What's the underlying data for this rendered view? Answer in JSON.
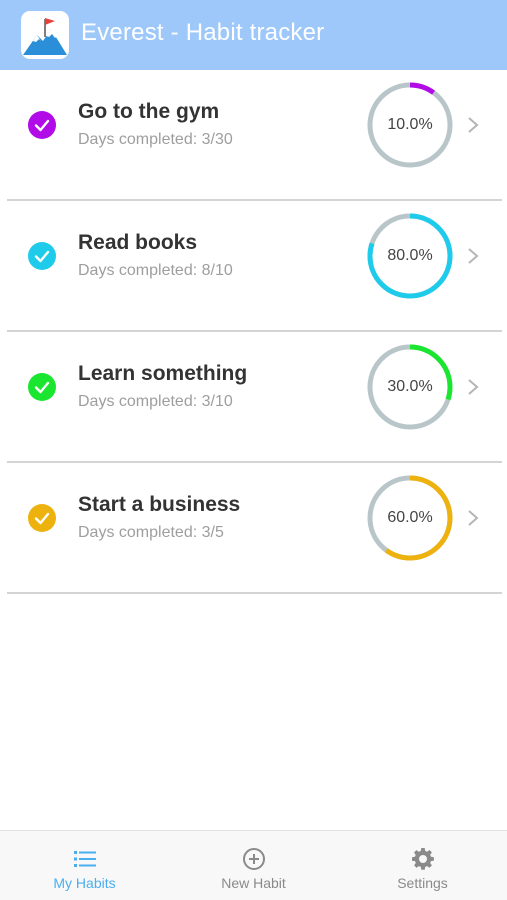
{
  "header": {
    "title": "Everest - Habit tracker",
    "icon": "mountain-flag-logo"
  },
  "habits": [
    {
      "name": "Go to the gym",
      "days": "Days completed: 3/30",
      "percent_label": "10.0%",
      "progress": 0.1,
      "color": "#b10ce8"
    },
    {
      "name": "Read books",
      "days": "Days completed: 8/10",
      "percent_label": "80.0%",
      "progress": 0.8,
      "color": "#1ecbea"
    },
    {
      "name": "Learn something",
      "days": "Days completed: 3/10",
      "percent_label": "30.0%",
      "progress": 0.3,
      "color": "#1be62f"
    },
    {
      "name": "Start a business",
      "days": "Days completed: 3/5",
      "percent_label": "60.0%",
      "progress": 0.6,
      "color": "#eeb20e"
    }
  ],
  "ring_track_color": "#b9c6c9",
  "tabbar": {
    "active_color": "#4aaff0",
    "inactive_color": "#8a8a8a",
    "tabs": [
      {
        "label": "My Habits",
        "icon": "list-icon",
        "active": true
      },
      {
        "label": "New Habit",
        "icon": "add-circle-icon",
        "active": false
      },
      {
        "label": "Settings",
        "icon": "gear-icon",
        "active": false
      }
    ]
  }
}
